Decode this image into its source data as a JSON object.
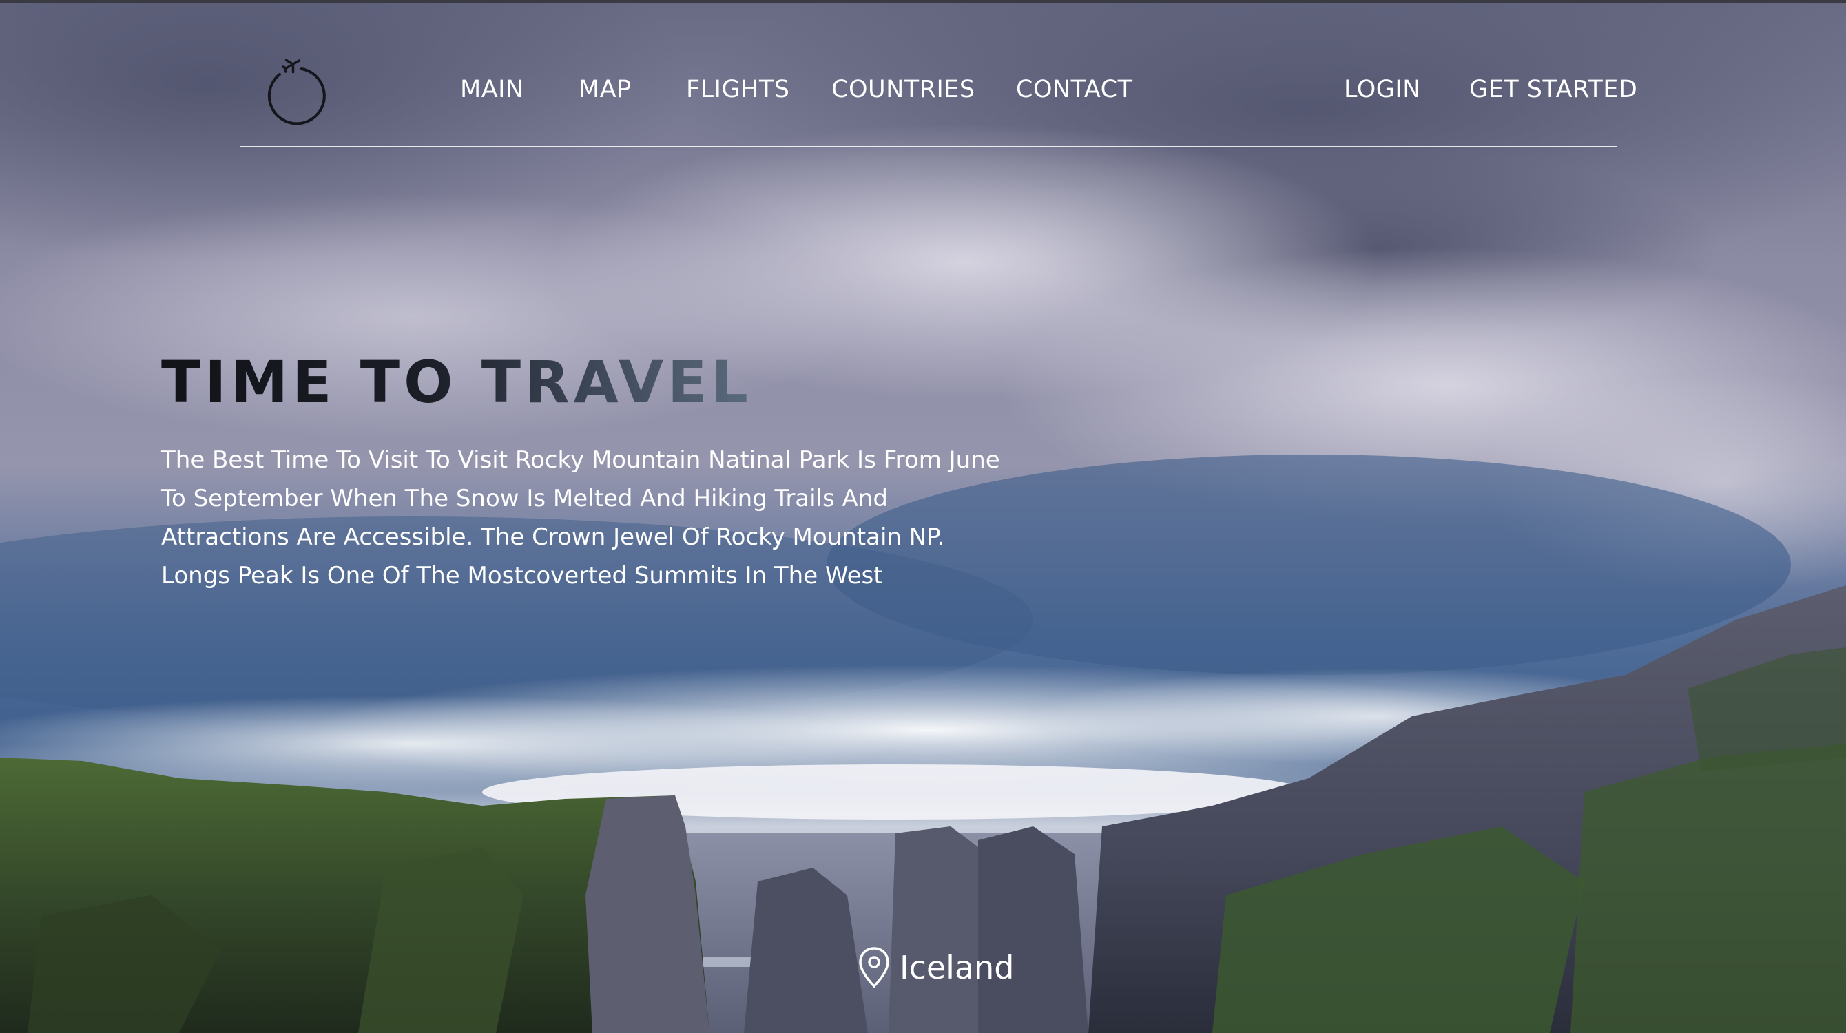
{
  "nav": {
    "links": [
      "MAIN",
      "MAP",
      "FLIGHTS",
      "COUNTRIES",
      "CONTACT"
    ],
    "login": "LOGIN",
    "get_started": "GET STARTED"
  },
  "hero": {
    "title": "TIME TO TRAVEL",
    "description": "The Best Time To Visit To Visit Rocky Mountain Natinal Park Is From June To September When The Snow Is Melted And Hiking Trails And Attractions Are Accessible. The Crown Jewel Of Rocky Mountain NP. Longs Peak Is One Of The Mostcoverted Summits In The West"
  },
  "location": {
    "name": "Iceland",
    "icon": "map-pin-icon"
  },
  "logo": {
    "icon": "airplane-orbit-icon"
  },
  "colors": {
    "sky_top": "#6b6d86",
    "sky_mid": "#9d9cb3",
    "sky_blue": "#3f5f8c",
    "cliff_green": "#3f5a2a",
    "cliff_rock": "#5a5a6c",
    "text": "#ffffff"
  }
}
